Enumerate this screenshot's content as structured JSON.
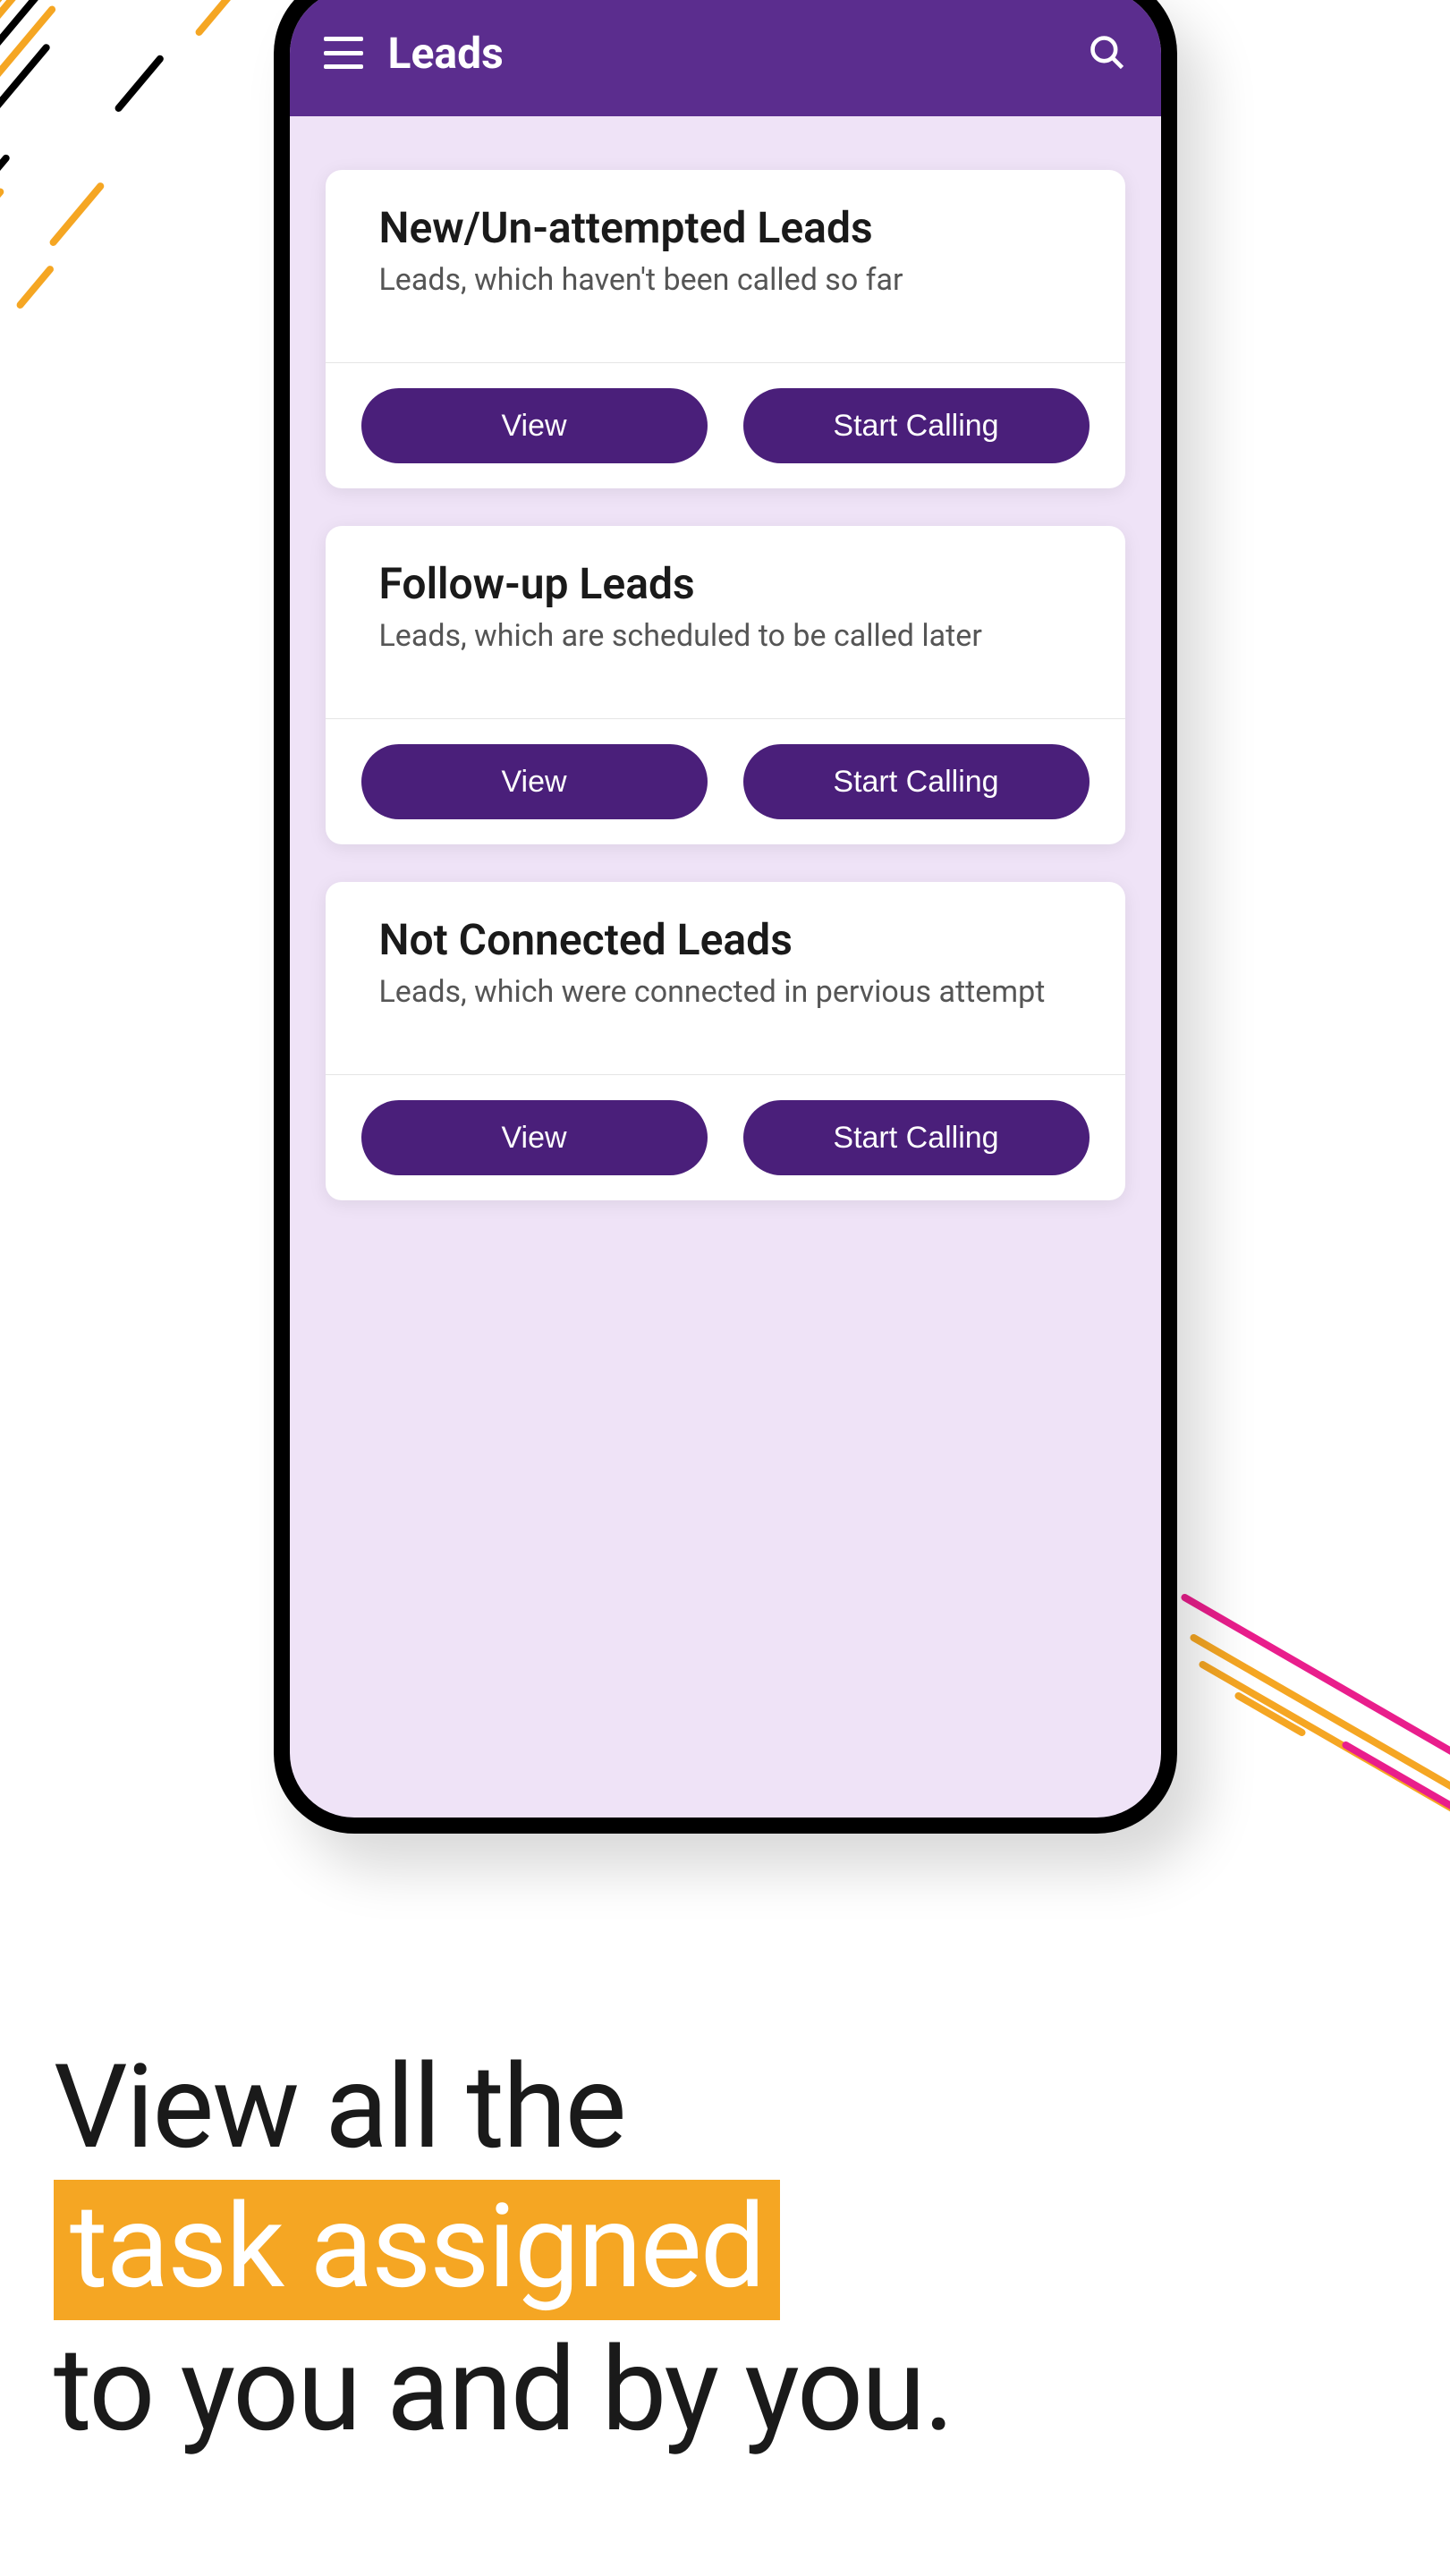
{
  "header": {
    "title": "Leads"
  },
  "cards": [
    {
      "title": "New/Un-attempted Leads",
      "subtitle": "Leads, which haven't been called so far",
      "view_label": "View",
      "call_label": "Start Calling"
    },
    {
      "title": "Follow-up Leads",
      "subtitle": "Leads, which are scheduled to be called later",
      "view_label": "View",
      "call_label": "Start Calling"
    },
    {
      "title": "Not Connected Leads",
      "subtitle": "Leads, which were connected in pervious attempt",
      "view_label": "View",
      "call_label": "Start Calling"
    }
  ],
  "caption": {
    "line1": "View all the",
    "highlight": "task assigned",
    "line3": "to you and by you."
  }
}
